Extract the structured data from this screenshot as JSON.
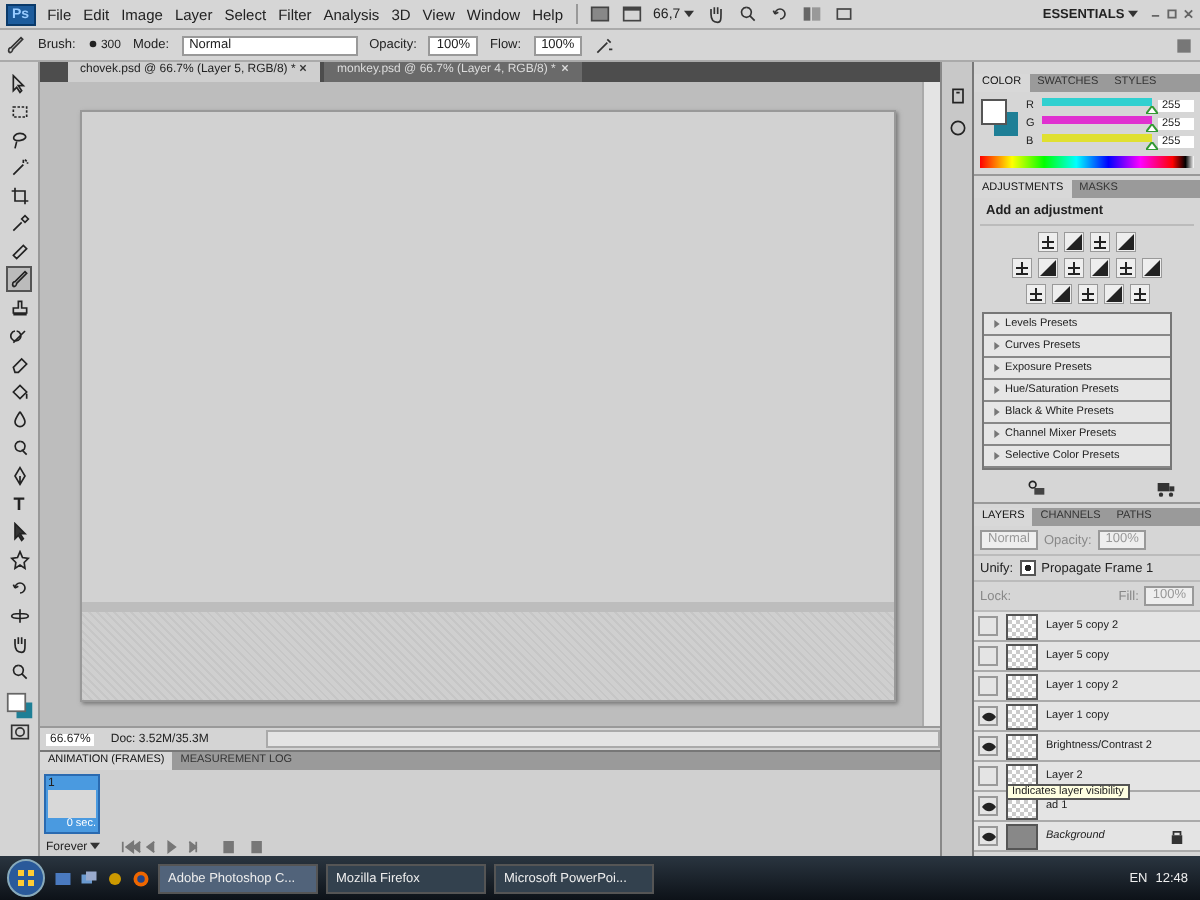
{
  "menu_bar": {
    "logo": "Ps",
    "items": [
      "File",
      "Edit",
      "Image",
      "Layer",
      "Select",
      "Filter",
      "Analysis",
      "3D",
      "View",
      "Window",
      "Help"
    ],
    "zoom": "66,7",
    "workspace": "ESSENTIALS"
  },
  "options_bar": {
    "brush_label": "Brush:",
    "brush_size": "300",
    "mode_label": "Mode:",
    "mode": "Normal",
    "opacity_label": "Opacity:",
    "opacity": "100%",
    "flow_label": "Flow:",
    "flow": "100%"
  },
  "tools": [
    {
      "kind": "move",
      "selected": false
    },
    {
      "kind": "marquee",
      "selected": false
    },
    {
      "kind": "lasso",
      "selected": false
    },
    {
      "kind": "wand",
      "selected": false
    },
    {
      "kind": "crop",
      "selected": false
    },
    {
      "kind": "eyedropper",
      "selected": false
    },
    {
      "kind": "bandage",
      "selected": false
    },
    {
      "kind": "brush",
      "selected": true
    },
    {
      "kind": "stamp",
      "selected": false
    },
    {
      "kind": "history",
      "selected": false
    },
    {
      "kind": "eraser",
      "selected": false
    },
    {
      "kind": "bucket",
      "selected": false
    },
    {
      "kind": "drop",
      "selected": false
    },
    {
      "kind": "dodge",
      "selected": false
    },
    {
      "kind": "pen",
      "selected": false
    },
    {
      "kind": "text",
      "glyph": "T",
      "selected": false
    },
    {
      "kind": "arrow",
      "selected": false
    },
    {
      "kind": "shape",
      "selected": false
    },
    {
      "kind": "rotate",
      "selected": false
    },
    {
      "kind": "orbit",
      "selected": false
    },
    {
      "kind": "hand",
      "selected": false
    },
    {
      "kind": "zoom",
      "selected": false
    }
  ],
  "document_tabs": [
    {
      "title": "chovek.psd @ 66.7% (Layer 5, RGB/8) *",
      "selected": true
    },
    {
      "title": "monkey.psd @ 66.7% (Layer 4, RGB/8) *",
      "selected": false
    }
  ],
  "status_bar": {
    "zoom": "66.67%",
    "doc_info": "Doc: 3.52M/35.3M"
  },
  "animation_panel": {
    "tabs": [
      {
        "label": "ANIMATION (FRAMES)",
        "selected": true
      },
      {
        "label": "MEASUREMENT LOG",
        "selected": false
      }
    ],
    "frames": [
      {
        "number": "1",
        "delay": "0 sec.",
        "selected": true
      }
    ],
    "loop": "Forever"
  },
  "color_panel": {
    "tabs": [
      {
        "label": "COLOR",
        "selected": true
      },
      {
        "label": "SWATCHES",
        "selected": false
      },
      {
        "label": "STYLES",
        "selected": false
      }
    ],
    "channels": [
      {
        "name": "R",
        "value": "255",
        "level": 1,
        "color": "#30d0d0"
      },
      {
        "name": "G",
        "value": "255",
        "level": 1,
        "color": "#e030d0"
      },
      {
        "name": "B",
        "value": "255",
        "level": 1,
        "color": "#e0e030"
      }
    ]
  },
  "adjustments_panel": {
    "tabs": [
      {
        "label": "ADJUSTMENTS",
        "selected": true
      },
      {
        "label": "MASKS",
        "selected": false
      }
    ],
    "heading": "Add an adjustment",
    "presets": [
      "Levels Presets",
      "Curves Presets",
      "Exposure Presets",
      "Hue/Saturation Presets",
      "Black & White Presets",
      "Channel Mixer Presets",
      "Selective Color Presets"
    ]
  },
  "layers_panel": {
    "tabs": [
      {
        "label": "LAYERS",
        "selected": true
      },
      {
        "label": "CHANNELS",
        "selected": false
      },
      {
        "label": "PATHS",
        "selected": false
      }
    ],
    "blend_mode": "Normal",
    "opacity_label": "Opacity:",
    "opacity": "100%",
    "unify_label": "Unify:",
    "propagate": {
      "label": "Propagate Frame 1",
      "checked": true
    },
    "lock_label": "Lock:",
    "fill_label": "Fill:",
    "fill": "100%",
    "layers": [
      {
        "name": "Layer 5 copy 2",
        "visible": false,
        "kind": "layer"
      },
      {
        "name": "Layer 5 copy",
        "visible": false,
        "kind": "layer"
      },
      {
        "name": "Layer 1 copy 2",
        "visible": false,
        "kind": "layer"
      },
      {
        "name": "Layer 1 copy",
        "visible": true,
        "kind": "layer"
      },
      {
        "name": "Brightness/Contrast 2",
        "visible": true,
        "kind": "layer"
      },
      {
        "name": "Layer 2",
        "visible": false,
        "kind": "layer"
      },
      {
        "name": "ad 1",
        "visible": true,
        "kind": "layer"
      },
      {
        "name": "Background",
        "visible": true,
        "kind": "background"
      }
    ],
    "tooltip": "Indicates layer visibility"
  },
  "taskbar": {
    "buttons": [
      {
        "label": "Adobe Photoshop C...",
        "selected": true
      },
      {
        "label": "Mozilla Firefox",
        "selected": false
      },
      {
        "label": "Microsoft PowerPoi...",
        "selected": false
      }
    ],
    "language": "EN",
    "time": "12:48"
  }
}
